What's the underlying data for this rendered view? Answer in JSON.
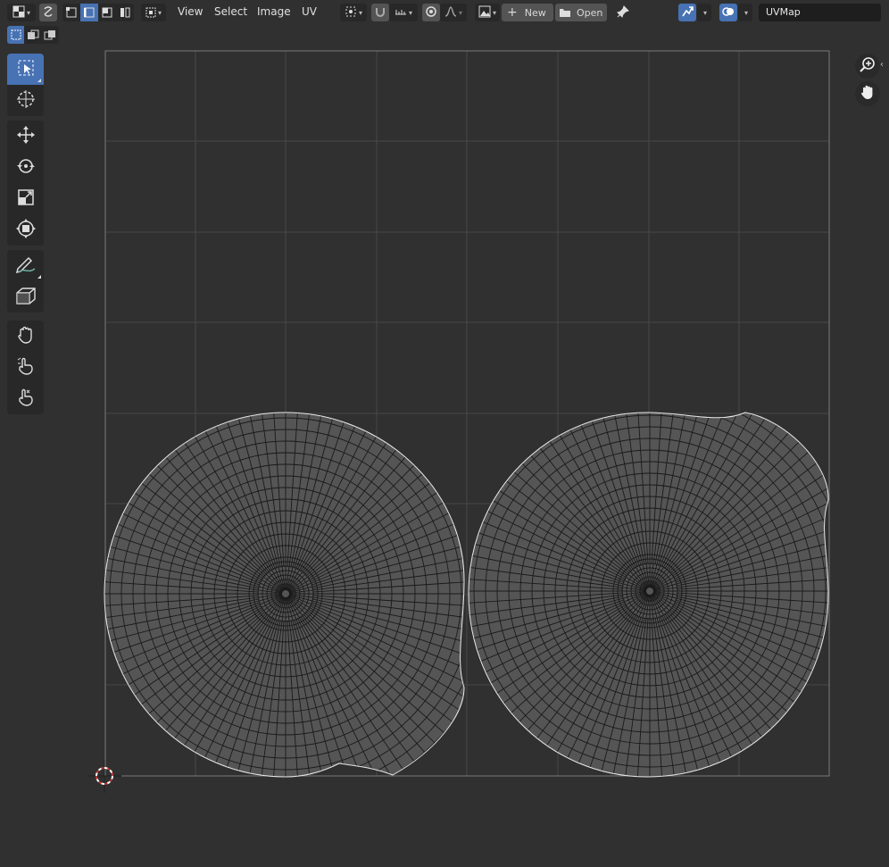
{
  "header": {
    "menus": [
      "View",
      "Select",
      "Image",
      "UV"
    ],
    "new_label": "New",
    "open_label": "Open",
    "uvmap_name": "UVMap"
  },
  "sidebar": {
    "tools": [
      "select-box-tool",
      "cursor-tool",
      "move-tool",
      "rotate-tool",
      "scale-tool",
      "transform-tool",
      "annotate-tool",
      "rip-region-tool",
      "grab-tool",
      "relax-tool",
      "pinch-tool"
    ]
  },
  "colors": {
    "background": "#303030",
    "accent": "#4772b3",
    "grid_line": "#4a4a4a",
    "uv_wire": "#000000",
    "uv_face": "#555555"
  }
}
